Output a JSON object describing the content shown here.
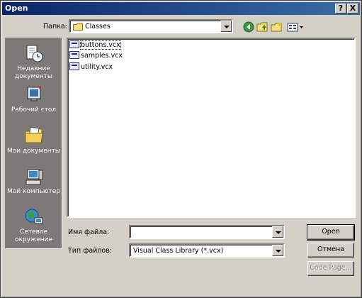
{
  "titlebar": {
    "title": "Open",
    "help_label": "?",
    "close_label": "X"
  },
  "lookin": {
    "label": "Папка:",
    "value": "Classes"
  },
  "toolbar": {
    "icons": [
      "back-icon",
      "up-folder-icon",
      "new-folder-icon",
      "view-menu-icon"
    ]
  },
  "places": [
    {
      "label": "Недавние документы",
      "icon": "recent-documents-icon"
    },
    {
      "label": "Рабочий стол",
      "icon": "desktop-icon"
    },
    {
      "label": "Мои документы",
      "icon": "my-documents-icon"
    },
    {
      "label": "Мой компьютер",
      "icon": "my-computer-icon"
    },
    {
      "label": "Сетевое окружение",
      "icon": "network-icon"
    }
  ],
  "files": [
    "buttons.vcx",
    "samples.vcx",
    "utility.vcx"
  ],
  "filename": {
    "label": "Имя файла:",
    "value": ""
  },
  "filetype": {
    "label": "Тип файлов:",
    "value": "Visual Class Library (*.vcx)"
  },
  "buttons": {
    "open": "Open",
    "cancel": "Отмена",
    "code_page": "Code Page..."
  }
}
